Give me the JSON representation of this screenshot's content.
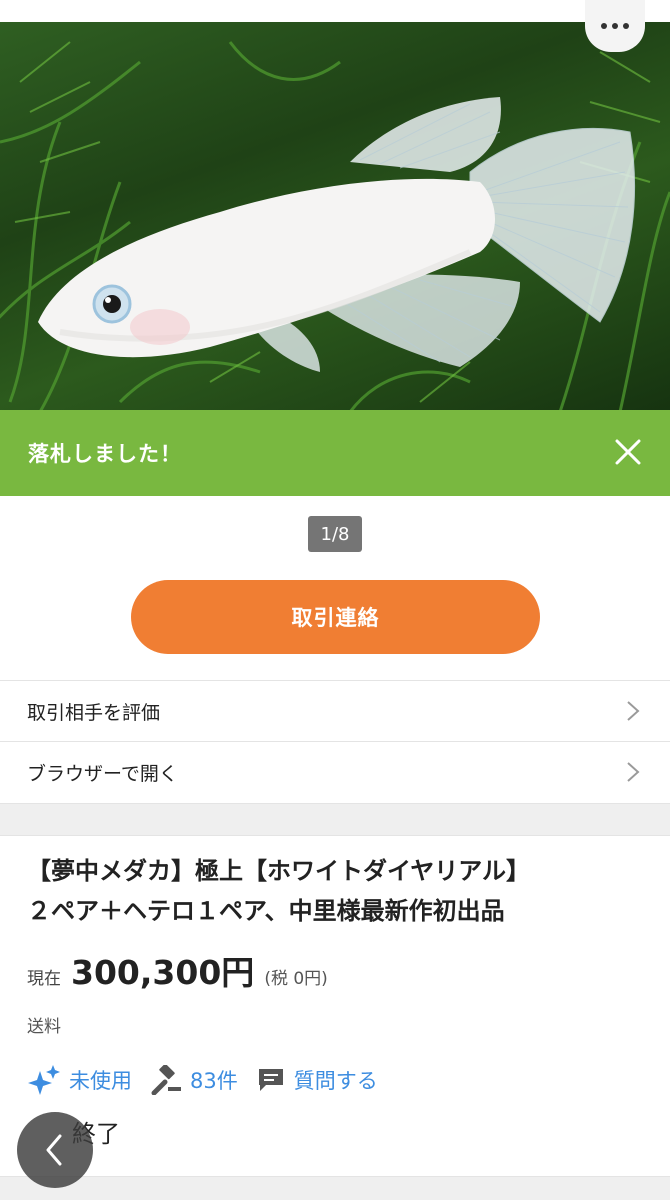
{
  "banner": {
    "text": "落札しました！"
  },
  "gallery": {
    "indicator": "1/8"
  },
  "actions": {
    "primary_label": "取引連絡"
  },
  "list": {
    "items": [
      {
        "label": "取引相手を評価"
      },
      {
        "label": "ブラウザーで開く"
      }
    ]
  },
  "item": {
    "title_line1": "【夢中メダカ】極上【ホワイトダイヤリアル】",
    "title_line2": "２ペア＋ヘテロ１ペア、中里様最新作初出品",
    "price_label": "現在",
    "price": "300,300円",
    "tax": "(税 0円)",
    "shipping_label": "送料",
    "condition": "未使用",
    "bids": "83件",
    "question": "質問する",
    "status": "終了"
  },
  "colors": {
    "banner": "#79b840",
    "primary_button": "#f07e33",
    "link": "#3d8de0"
  },
  "icons": [
    "more-icon",
    "close-icon",
    "chevron-right-icon",
    "sparkle-icon",
    "gavel-icon",
    "chat-icon",
    "back-icon"
  ]
}
